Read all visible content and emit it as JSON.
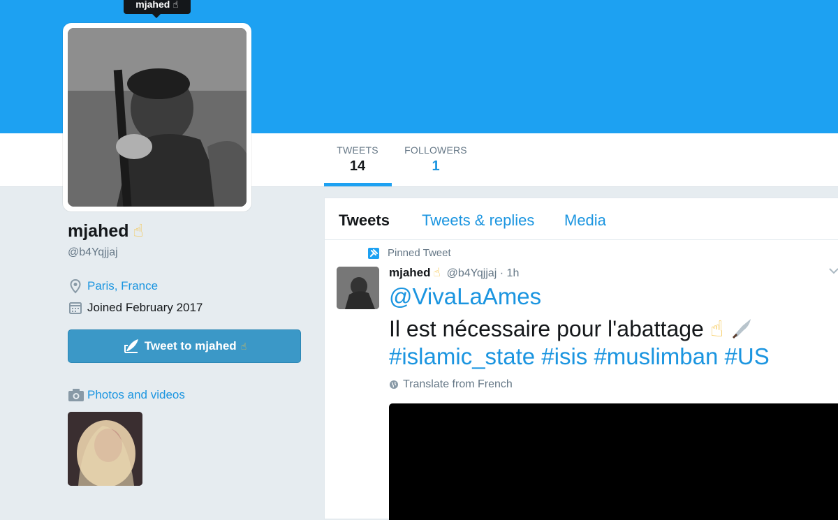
{
  "tooltip": {
    "text": "mjahed ☝"
  },
  "nav": {
    "tweets_label": "TWEETS",
    "tweets_count": "14",
    "followers_label": "FOLLOWERS",
    "followers_count": "1"
  },
  "profile": {
    "name": "mjahed",
    "name_emoji": "☝",
    "handle": "@b4Yqjjaj",
    "location": "Paris, France",
    "joined": "Joined February 2017",
    "tweet_to_label": "Tweet to mjahed",
    "tweet_to_emoji": "☝",
    "photos_label": "Photos and videos"
  },
  "timeline": {
    "tabs": [
      {
        "label": "Tweets"
      },
      {
        "label": "Tweets & replies"
      },
      {
        "label": "Media"
      }
    ],
    "pinned_label": "Pinned Tweet",
    "tweet": {
      "name": "mjahed",
      "name_emoji": "☝",
      "handle_time": "@b4Yqjjaj · 1h",
      "mention": "@VivaLaAmes",
      "text": "Il est nécessaire pour l'abattage",
      "text_emoji": "☝",
      "hashtags": "#islamic_state #isis #muslimban #US",
      "translate_label": "Translate from French"
    }
  },
  "colors": {
    "banner": "#1da1f2",
    "link": "#1b95e0",
    "button": "#3b98c7"
  },
  "icons": [
    "map-pin-icon",
    "calendar-icon",
    "quill-icon",
    "camera-icon",
    "pin-icon",
    "chevron-down-icon",
    "globe-icon",
    "knife-icon"
  ]
}
